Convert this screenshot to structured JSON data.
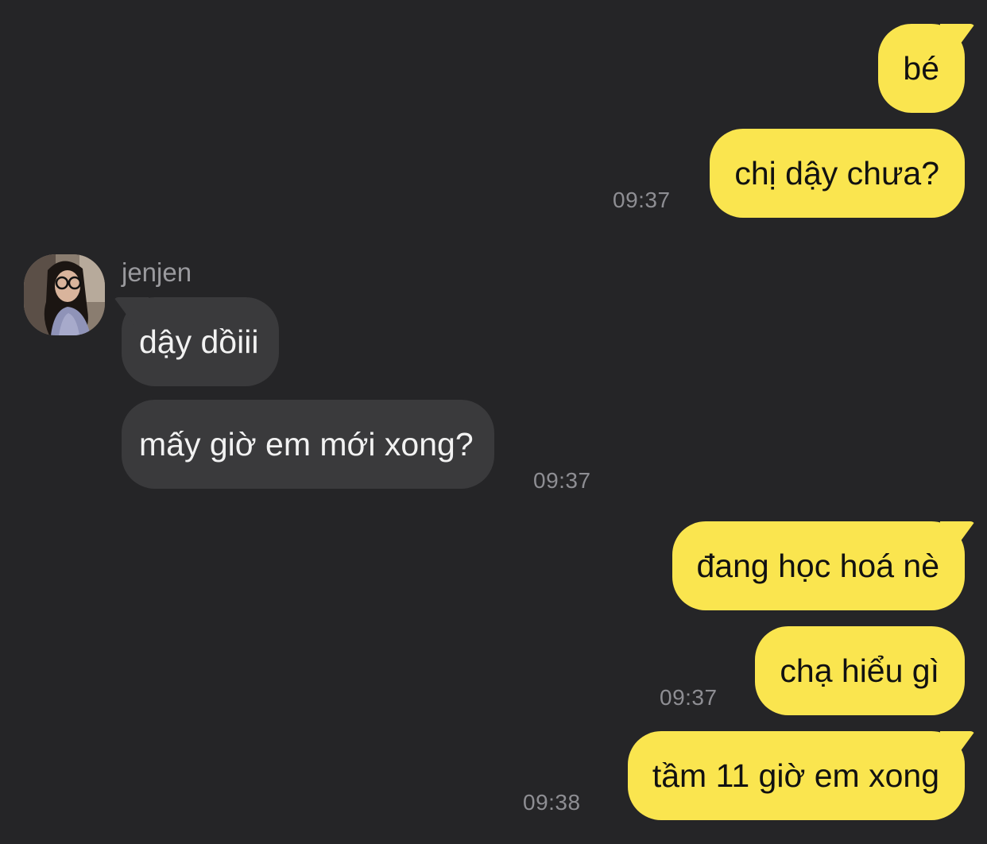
{
  "theme": {
    "background": "#252527",
    "outgoing_bubble": "#fae54f",
    "incoming_bubble": "#3a3a3c",
    "timestamp_color": "#8e8e93"
  },
  "contact": {
    "name": "jenjen",
    "avatar_icon": "profile-photo"
  },
  "messages": [
    {
      "text": "bé"
    },
    {
      "text": "chị dậy chưa?",
      "time": "09:37"
    },
    {
      "text": "dậy dồiii"
    },
    {
      "text": "mấy giờ em mới xong?",
      "time": "09:37"
    },
    {
      "text": "đang học hoá nè"
    },
    {
      "text": "chạ hiểu gì",
      "time": "09:37"
    },
    {
      "text": "tầm 11 giờ em xong",
      "time": "09:38"
    }
  ]
}
